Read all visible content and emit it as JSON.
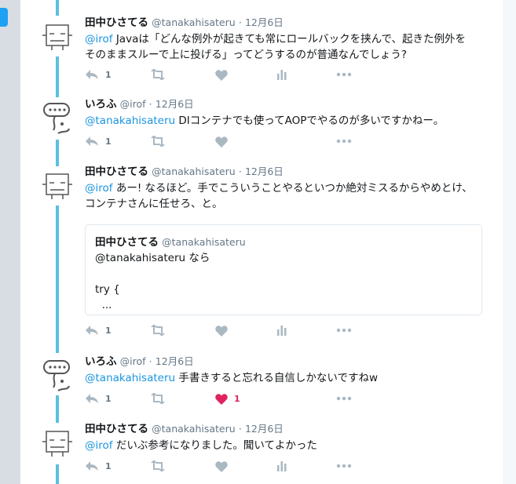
{
  "tweets": [
    {
      "name": "田中ひさてる",
      "handle": "@tanakahisateru",
      "sep": "·",
      "time": "12月6日",
      "avatar": "robot-face-avatar",
      "text_line1_mention": "@irof",
      "text_line1": " Javaは「どんな例外が起きても常にロールバックを挟んで、起きた例外を",
      "text_line2": "そのままスルーで上に投げる」ってどうするのが普通なんでしょう?",
      "reply_count": "1",
      "like_count": ""
    },
    {
      "name": "いろふ",
      "handle": "@irof",
      "sep": "·",
      "time": "12月6日",
      "avatar": "speech-bubble-avatar",
      "text_line1_mention": "@tanakahisateru",
      "text_line1": " DIコンテナでも使ってAOPでやるのが多いですかねー。",
      "reply_count": "1",
      "like_count": ""
    },
    {
      "name": "田中ひさてる",
      "handle": "@tanakahisateru",
      "sep": "·",
      "time": "12月6日",
      "avatar": "robot-face-avatar",
      "text_line1_mention": "@irof",
      "text_line1": " あー! なるほど。手でこういうことやるといつか絶対ミスるからやめとけ、",
      "text_line2": "コンテナさんに任せろ、と。",
      "quote": {
        "name": "田中ひさてる",
        "handle": "@tanakahisateru",
        "text": "@tanakahisateru なら\n\ntry {\n  ..."
      },
      "reply_count": "1",
      "like_count": ""
    },
    {
      "name": "いろふ",
      "handle": "@irof",
      "sep": "·",
      "time": "12月6日",
      "avatar": "speech-bubble-avatar",
      "text_line1_mention": "@tanakahisateru",
      "text_line1": " 手書きすると忘れる自信しかないですねw",
      "reply_count": "1",
      "like_count": "1",
      "liked": true
    },
    {
      "name": "田中ひさてる",
      "handle": "@tanakahisateru",
      "sep": "·",
      "time": "12月6日",
      "avatar": "robot-face-avatar",
      "text_line1_mention": "@irof",
      "text_line1": " だいぶ参考になりました。聞いてよかった",
      "reply_count": "1",
      "like_count": ""
    }
  ],
  "colors": {
    "thread_line": "#5bc0de",
    "mention": "#1b95e0",
    "like_active": "#e0245e",
    "icon": "#aab8c2"
  }
}
